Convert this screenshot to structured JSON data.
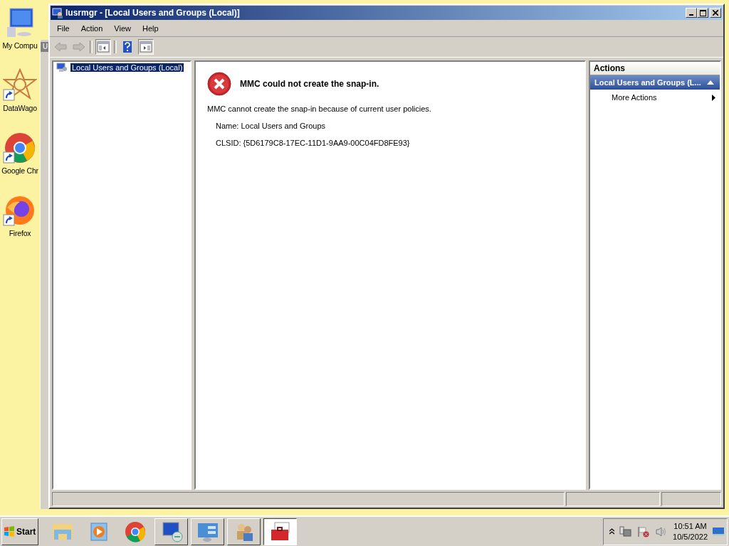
{
  "desktop_icons": [
    {
      "label": "My Compu",
      "kind": "computer",
      "shortcut": false
    },
    {
      "label": "DataWago",
      "kind": "star",
      "shortcut": true
    },
    {
      "label": "Google Chr",
      "kind": "chrome",
      "shortcut": true
    },
    {
      "label": "Firefox",
      "kind": "firefox",
      "shortcut": true
    }
  ],
  "behind_window": {
    "title": "U"
  },
  "window": {
    "title": "lusrmgr - [Local Users and Groups (Local)]"
  },
  "menu": [
    "File",
    "Action",
    "View",
    "Help"
  ],
  "toolbar": [
    {
      "kind": "back",
      "disabled": true,
      "selected": false
    },
    {
      "kind": "forward",
      "disabled": true,
      "selected": false
    },
    {
      "kind": "tree",
      "disabled": false,
      "selected": true
    },
    {
      "kind": "help",
      "disabled": false,
      "selected": false
    },
    {
      "kind": "actionpane",
      "disabled": false,
      "selected": true
    }
  ],
  "tree": [
    {
      "label": "Local Users and Groups (Local)",
      "selected": true
    }
  ],
  "error": {
    "heading": "MMC could not create the snap-in.",
    "message": "MMC cannot create the snap-in because of current user policies.",
    "details": [
      "Name: Local Users and Groups",
      "CLSID: {5D6179C8-17EC-11D1-9AA9-00C04FD8FE93}"
    ]
  },
  "actions": {
    "title": "Actions",
    "section": "Local Users and Groups (L...",
    "items": [
      "More Actions"
    ]
  },
  "taskbar": {
    "start": "Start",
    "items": [
      {
        "kind": "folder",
        "button": false,
        "selected": false
      },
      {
        "kind": "media",
        "button": false,
        "selected": false
      },
      {
        "kind": "chrome",
        "button": false,
        "selected": false
      },
      {
        "kind": "remote",
        "button": true,
        "selected": false
      },
      {
        "kind": "panel",
        "button": true,
        "selected": false
      },
      {
        "kind": "users",
        "button": true,
        "selected": false
      },
      {
        "kind": "toolbox",
        "button": true,
        "selected": true
      }
    ],
    "tray": [
      {
        "kind": "network"
      },
      {
        "kind": "flag"
      },
      {
        "kind": "volume"
      }
    ],
    "time": "10:51 AM",
    "date": "10/5/2022"
  }
}
